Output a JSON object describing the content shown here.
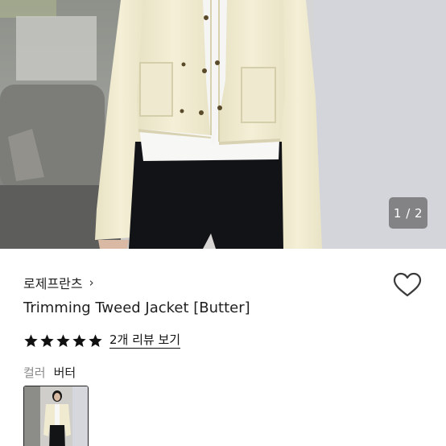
{
  "gallery": {
    "current_page": 1,
    "total_pages": 2,
    "counter_text": "1 / 2"
  },
  "product": {
    "brand": "로제프란츠",
    "brand_chevron": "›",
    "title": "Trimming Tweed Jacket [Butter]",
    "rating_stars": 5,
    "review_link": "2개 리뷰 보기",
    "option_label": "컬러",
    "option_value": "버터"
  },
  "icons": {
    "wishlist": "heart-outline-icon",
    "star": "star-filled-icon",
    "chevron": "chevron-right-icon"
  },
  "colors": {
    "star": "#111111",
    "jacket": "#f1ecd2",
    "counter_bg": "#505050"
  }
}
